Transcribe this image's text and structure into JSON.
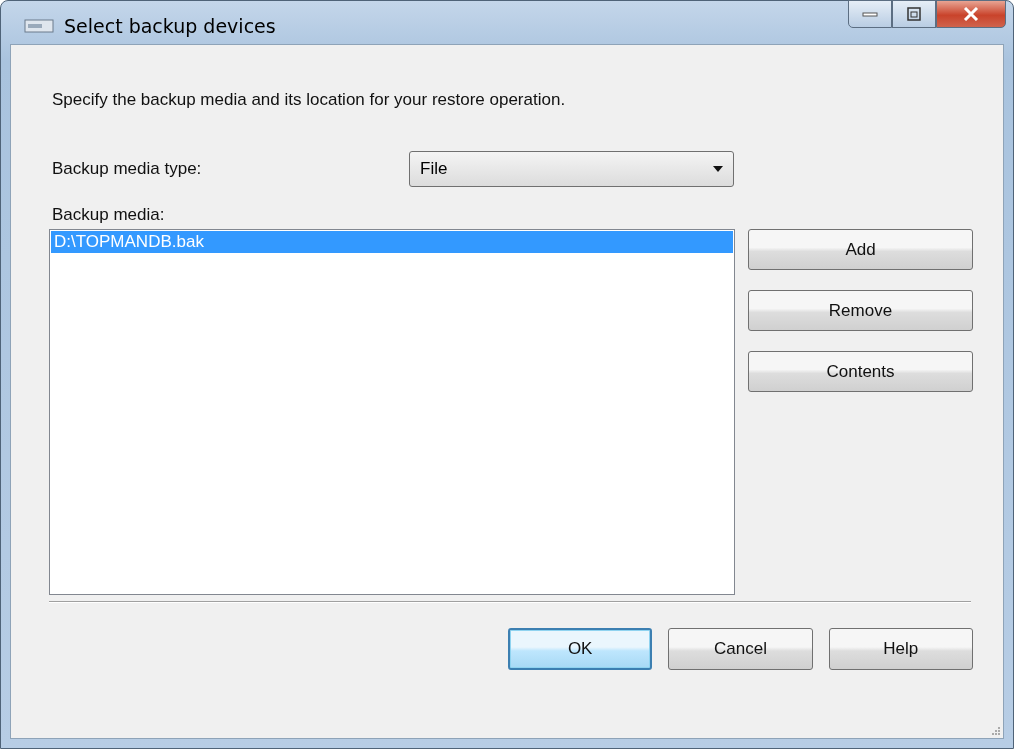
{
  "window": {
    "title": "Select backup devices"
  },
  "description": "Specify the backup media and its location for your restore operation.",
  "media_type": {
    "label": "Backup media type:",
    "value": "File"
  },
  "media": {
    "label": "Backup media:",
    "items": [
      {
        "text": "D:\\TOPMANDB.bak",
        "selected": true
      }
    ]
  },
  "side_buttons": [
    "Add",
    "Remove",
    "Contents"
  ],
  "footer_buttons": [
    {
      "label": "OK",
      "default": true
    },
    {
      "label": "Cancel",
      "default": false
    },
    {
      "label": "Help",
      "default": false
    }
  ]
}
